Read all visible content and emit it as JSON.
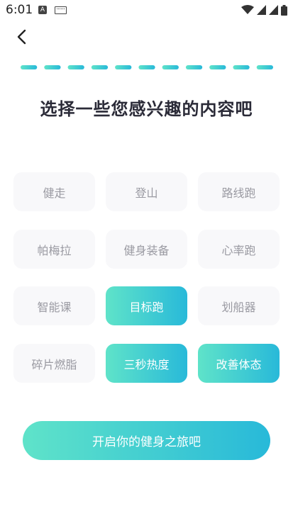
{
  "status_bar": {
    "time": "6:01",
    "a_badge": "A",
    "icons": [
      "keyboard-icon",
      "wifi-icon",
      "signal-icon",
      "signal-icon",
      "battery-icon"
    ]
  },
  "header": {
    "back_icon": "chevron-left-icon"
  },
  "progress": {
    "segments_total": 11,
    "accent_start": "#5fe3c9",
    "accent_end": "#28b9d9"
  },
  "title": "选择一些您感兴趣的内容吧",
  "interests": [
    {
      "label": "健走",
      "selected": false
    },
    {
      "label": "登山",
      "selected": false
    },
    {
      "label": "路线跑",
      "selected": false
    },
    {
      "label": "帕梅拉",
      "selected": false
    },
    {
      "label": "健身装备",
      "selected": false
    },
    {
      "label": "心率跑",
      "selected": false
    },
    {
      "label": "智能课",
      "selected": false
    },
    {
      "label": "目标跑",
      "selected": true
    },
    {
      "label": "划船器",
      "selected": false
    },
    {
      "label": "碎片燃脂",
      "selected": false
    },
    {
      "label": "三秒热度",
      "selected": true
    },
    {
      "label": "改善体态",
      "selected": true
    }
  ],
  "cta_label": "开启你的健身之旅吧"
}
